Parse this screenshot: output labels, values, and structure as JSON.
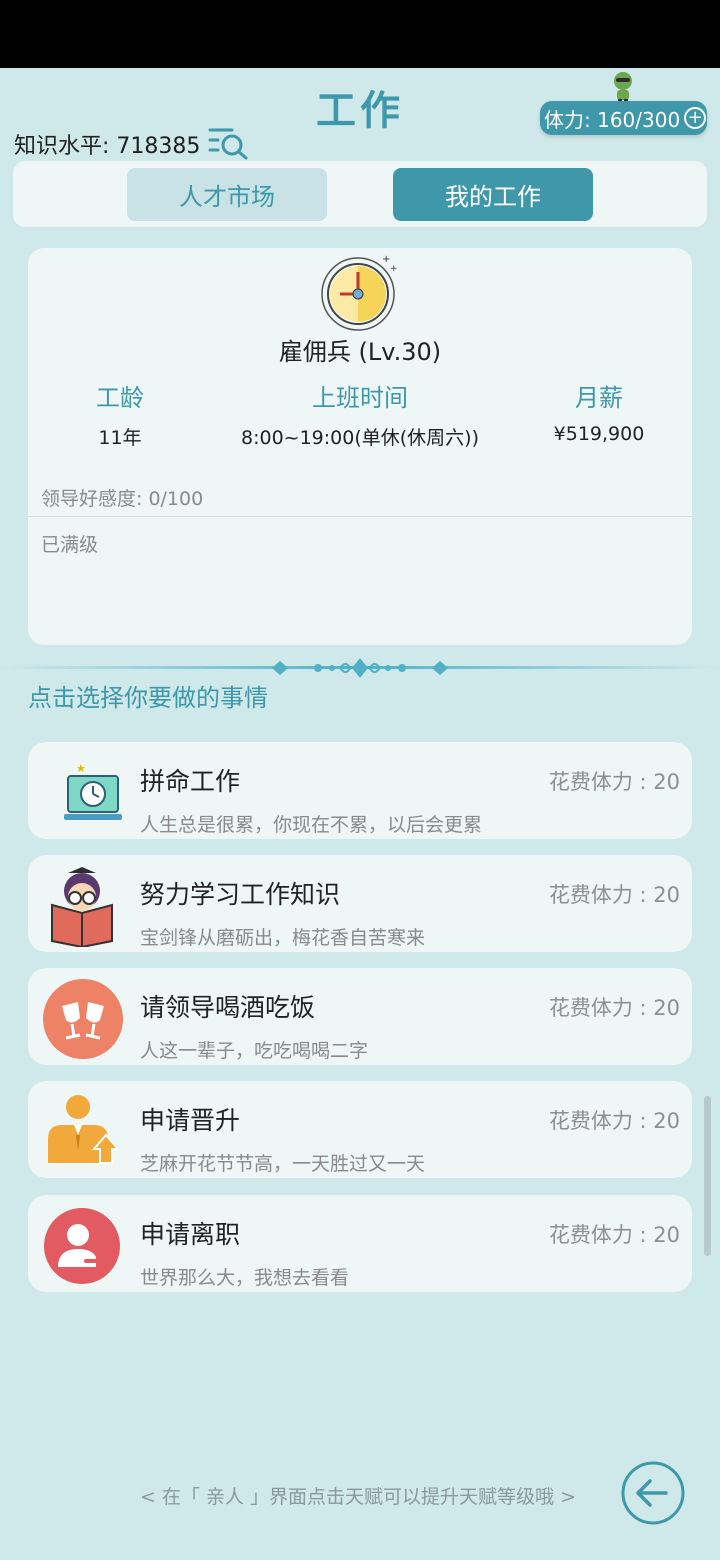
{
  "header": {
    "title": "工作",
    "knowledge_label": "知识水平: 718385",
    "stamina_label": "体力: 160/300",
    "stamina_plus": "+"
  },
  "tabs": [
    {
      "label": "人才市场",
      "active": false
    },
    {
      "label": "我的工作",
      "active": true
    }
  ],
  "job": {
    "title": "雇佣兵 (Lv.30)",
    "stats": [
      {
        "label": "工龄",
        "value": "11年"
      },
      {
        "label": "上班时间",
        "value": "8:00~19:00(单休(休周六))"
      },
      {
        "label": "月薪",
        "value": "¥519,900"
      }
    ],
    "favor": "领导好感度: 0/100",
    "status": "已满级"
  },
  "section_title": "点击选择你要做的事情",
  "actions": [
    {
      "name": "拼命工作",
      "cost": "花费体力 : 20",
      "desc": "人生总是很累，你现在不累，以后会更累",
      "icon": "night-work-icon"
    },
    {
      "name": "努力学习工作知识",
      "cost": "花费体力 : 20",
      "desc": "宝剑锋从磨砺出，梅花香自苦寒来",
      "icon": "study-book-icon"
    },
    {
      "name": "请领导喝酒吃饭",
      "cost": "花费体力 : 20",
      "desc": "人这一辈子，吃吃喝喝二字",
      "icon": "toast-glasses-icon"
    },
    {
      "name": "申请晋升",
      "cost": "花费体力 : 20",
      "desc": "芝麻开花节节高，一天胜过又一天",
      "icon": "promotion-icon"
    },
    {
      "name": "申请离职",
      "cost": "花费体力 : 20",
      "desc": "世界那么大，我想去看看",
      "icon": "resign-icon"
    }
  ],
  "footer": {
    "tip": "< 在「 亲人 」界面点击天赋可以提升天赋等级哦 >"
  },
  "colors": {
    "accent": "#3f98a9",
    "background": "#cfe8ea",
    "card": "#eef6f6"
  }
}
